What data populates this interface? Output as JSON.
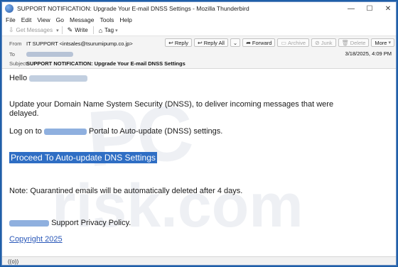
{
  "window": {
    "title": "SUPPORT NOTIFICATION: Upgrade Your E-mail DNSS Settings - Mozilla Thunderbird",
    "controls": {
      "minimize": "—",
      "maximize": "☐",
      "close": "✕"
    }
  },
  "menu": [
    "File",
    "Edit",
    "View",
    "Go",
    "Message",
    "Tools",
    "Help"
  ],
  "toolbar": {
    "get_messages": "Get Messages",
    "write": "Write",
    "tag": "Tag"
  },
  "header": {
    "from_label": "From",
    "from_value": "IT SUPPORT <intsales@tsurumipump.co.jp>",
    "to_label": "To",
    "subject_label": "Subject",
    "subject_value": "SUPPORT NOTIFICATION: Upgrade Your E-mail DNSS Settings",
    "date": "3/18/2025, 4:09 PM",
    "actions": {
      "reply": "Reply",
      "reply_all": "Reply All",
      "forward": "Forward",
      "archive": "Archive",
      "junk": "Junk",
      "delete": "Delete",
      "more": "More"
    }
  },
  "message": {
    "greeting": "Hello",
    "para1_line1": "Update your Domain Name System Security (DNSS), to deliver incoming messages that were",
    "para1_line2": "delayed.",
    "logon_prefix": "Log on to",
    "logon_suffix": "Portal to Auto-update (DNSS) settings.",
    "cta": "Proceed To Auto-update DNS Settings",
    "note": "Note: Quarantined emails will be automatically deleted after 4 days.",
    "privacy_suffix": "Support Privacy Policy.",
    "copyright": "Copyright 2025"
  },
  "status": {
    "icon": "((o))"
  },
  "colors": {
    "accent": "#2f6ec4",
    "link": "#2957b8",
    "frame": "#1f5fa8"
  }
}
